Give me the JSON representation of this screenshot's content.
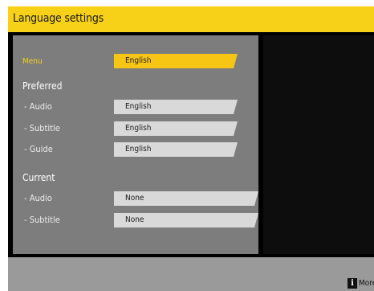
{
  "header": {
    "title": "Language settings"
  },
  "menu": {
    "label": "Menu",
    "value": "English"
  },
  "preferred": {
    "heading": "Preferred",
    "audio": {
      "label": "- Audio",
      "value": "English"
    },
    "subtitle": {
      "label": "- Subtitle",
      "value": "English"
    },
    "guide": {
      "label": "- Guide",
      "value": "English"
    }
  },
  "current": {
    "heading": "Current",
    "audio": {
      "label": "- Audio",
      "value": "None"
    },
    "subtitle": {
      "label": "- Subtitle",
      "value": "None"
    }
  },
  "footer": {
    "more_label": "More",
    "info_icon": "info-icon"
  },
  "colors": {
    "accent": "#f7d117",
    "panel": "#7d7d7d",
    "field": "#d9d9d9"
  }
}
